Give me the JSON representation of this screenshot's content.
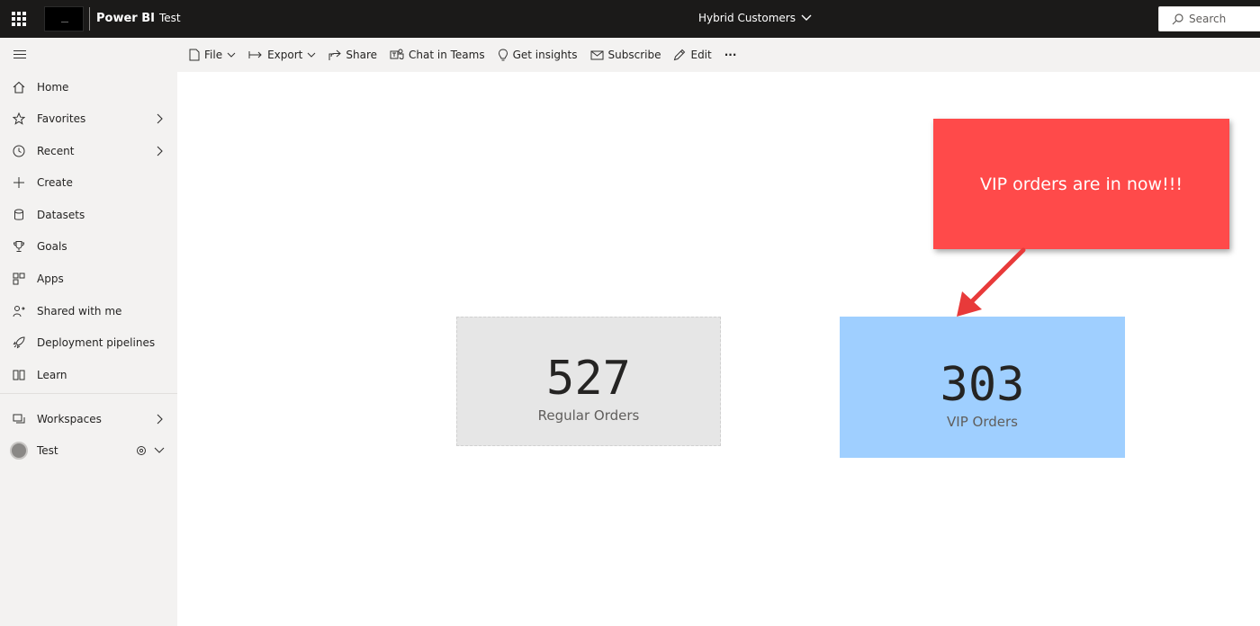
{
  "header": {
    "product": "Power BI",
    "workspace": "Test",
    "report_title": "Hybrid Customers",
    "search_placeholder": "Search"
  },
  "sidebar": {
    "items": [
      {
        "label": "Home",
        "icon": "home-icon"
      },
      {
        "label": "Favorites",
        "icon": "star-icon"
      },
      {
        "label": "Recent",
        "icon": "clock-icon"
      },
      {
        "label": "Create",
        "icon": "plus-icon"
      },
      {
        "label": "Datasets",
        "icon": "database-icon"
      },
      {
        "label": "Goals",
        "icon": "trophy-icon"
      },
      {
        "label": "Apps",
        "icon": "apps-icon"
      },
      {
        "label": "Shared with me",
        "icon": "shared-icon"
      },
      {
        "label": "Deployment pipelines",
        "icon": "rocket-icon"
      },
      {
        "label": "Learn",
        "icon": "book-icon"
      },
      {
        "label": "Workspaces",
        "icon": "workspaces-icon"
      },
      {
        "label": "Test",
        "icon": "workspace-avatar"
      }
    ]
  },
  "commands": {
    "file": "File",
    "export": "Export",
    "share": "Share",
    "chat": "Chat in Teams",
    "insights": "Get insights",
    "subscribe": "Subscribe",
    "edit": "Edit",
    "more": "···"
  },
  "cards": {
    "regular": {
      "value": "527",
      "label": "Regular Orders"
    },
    "vip": {
      "value": "303",
      "label": "VIP Orders"
    }
  },
  "callout": {
    "text": "VIP orders are in now!!!"
  },
  "colors": {
    "topbar": "#1b1a19",
    "sidebar": "#f3f2f1",
    "regular_card": "#e6e6e6",
    "vip_card": "#9fcfff",
    "callout": "#ff4a4a"
  }
}
